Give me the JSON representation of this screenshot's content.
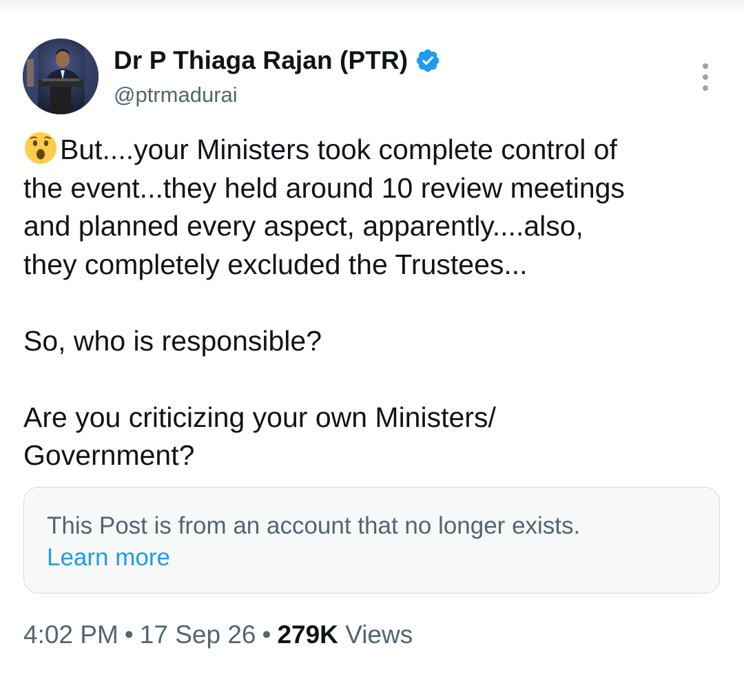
{
  "author": {
    "display_name": "Dr P Thiaga Rajan (PTR)",
    "handle": "@ptrmadurai",
    "verified_icon": "verified-badge-icon",
    "badge_color": "#1d9bf0"
  },
  "menu": {
    "icon": "more-options-icon"
  },
  "tweet": {
    "emoji": "astonished-face-emoji",
    "paragraph1": "But....your Ministers took complete control of\nthe event...they held around 10 review meetings\nand planned every aspect, apparently....also,\nthey completely excluded the Trustees...",
    "paragraph2": "So, who is responsible?",
    "paragraph3": "Are you criticizing your own Ministers/\nGovernment?"
  },
  "quoted_notice": {
    "text": "This Post is from an account that no longer exists.",
    "link": "Learn more",
    "link_color": "#1d9bf0"
  },
  "meta": {
    "time": "4:02 PM",
    "separator": "•",
    "date": "17 Sep 26",
    "views_count": "279K",
    "views_label": "Views"
  }
}
